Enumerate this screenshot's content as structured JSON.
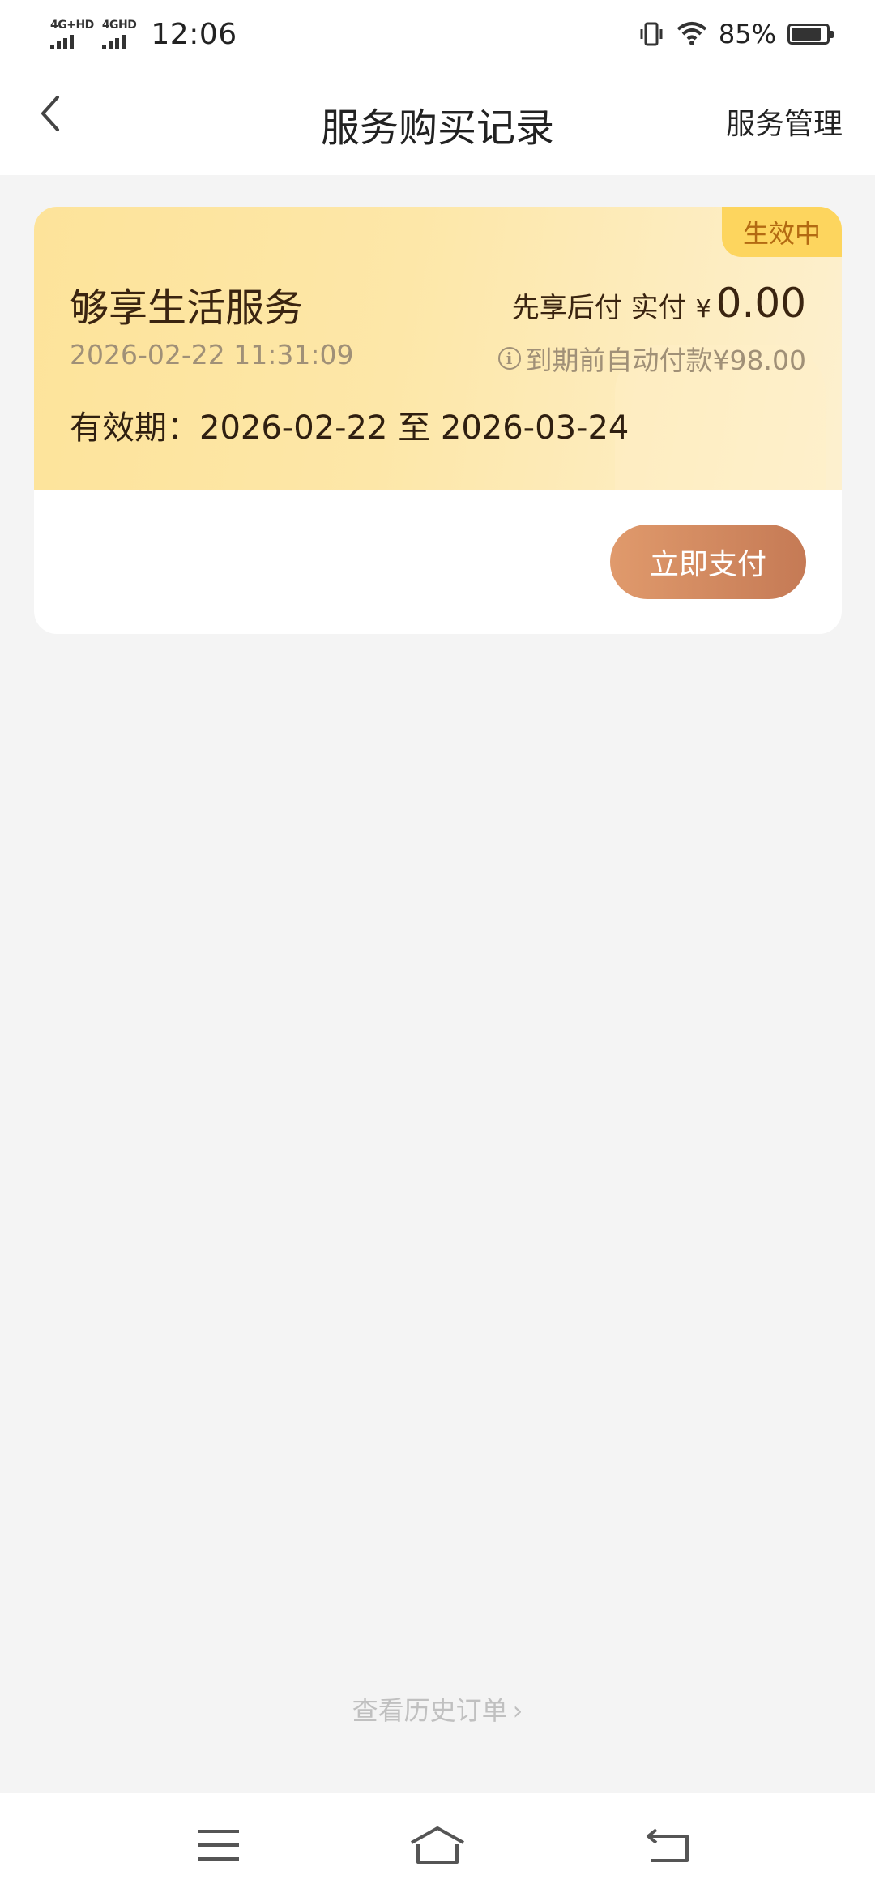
{
  "status_bar": {
    "network1": "4G+HD",
    "network2": "4GHD",
    "time": "12:06",
    "battery_percent": "85%",
    "battery_level": 0.85
  },
  "header": {
    "title": "服务购买记录",
    "action": "服务管理"
  },
  "card": {
    "status": "生效中",
    "service_name": "够享生活服务",
    "pay_desc": "先享后付 实付",
    "currency": "¥",
    "amount": "0.00",
    "order_time": "2026-02-22 11:31:09",
    "auto_pay": "到期前自动付款¥98.00",
    "validity": "有效期：2026-02-22 至 2026-03-24",
    "pay_button": "立即支付"
  },
  "history_link": "查看历史订单",
  "icons": {
    "back": "chevron-left-icon",
    "info": "info-icon",
    "menu": "menu-icon",
    "home": "home-icon",
    "return": "return-icon"
  }
}
